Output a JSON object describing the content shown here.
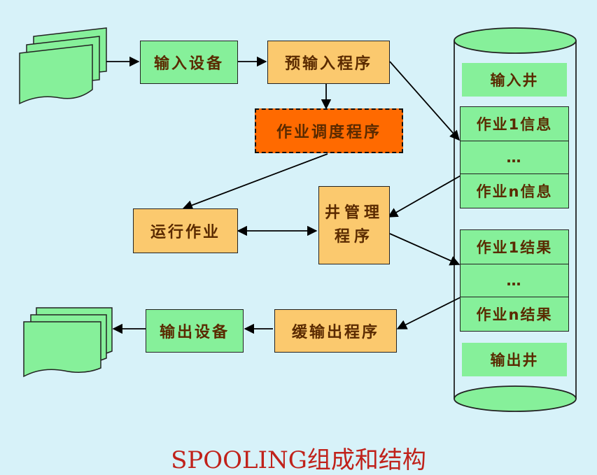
{
  "diagram": {
    "boxes": {
      "input_device": "输入设备",
      "pre_input_program": "预输入程序",
      "job_scheduler": "作业调度程序",
      "run_job": "运行作业",
      "well_manager_line1": "井管理",
      "well_manager_line2": "程序",
      "buffered_output_program": "缓输出程序",
      "output_device": "输出设备"
    },
    "cylinder": {
      "input_well": "输入井",
      "job_info_1": "作业1信息",
      "job_info_ellipsis": "…",
      "job_info_n": "作业n信息",
      "job_result_1": "作业1结果",
      "job_result_ellipsis": "…",
      "job_result_n": "作业n结果",
      "output_well": "输出井"
    },
    "caption": "SPOOLING组成和结构"
  },
  "colors": {
    "background": "#d7f2f9",
    "green": "#86f09a",
    "orange": "#fbc96e",
    "red_orange": "#ff6a00",
    "caption": "#c0221b"
  }
}
